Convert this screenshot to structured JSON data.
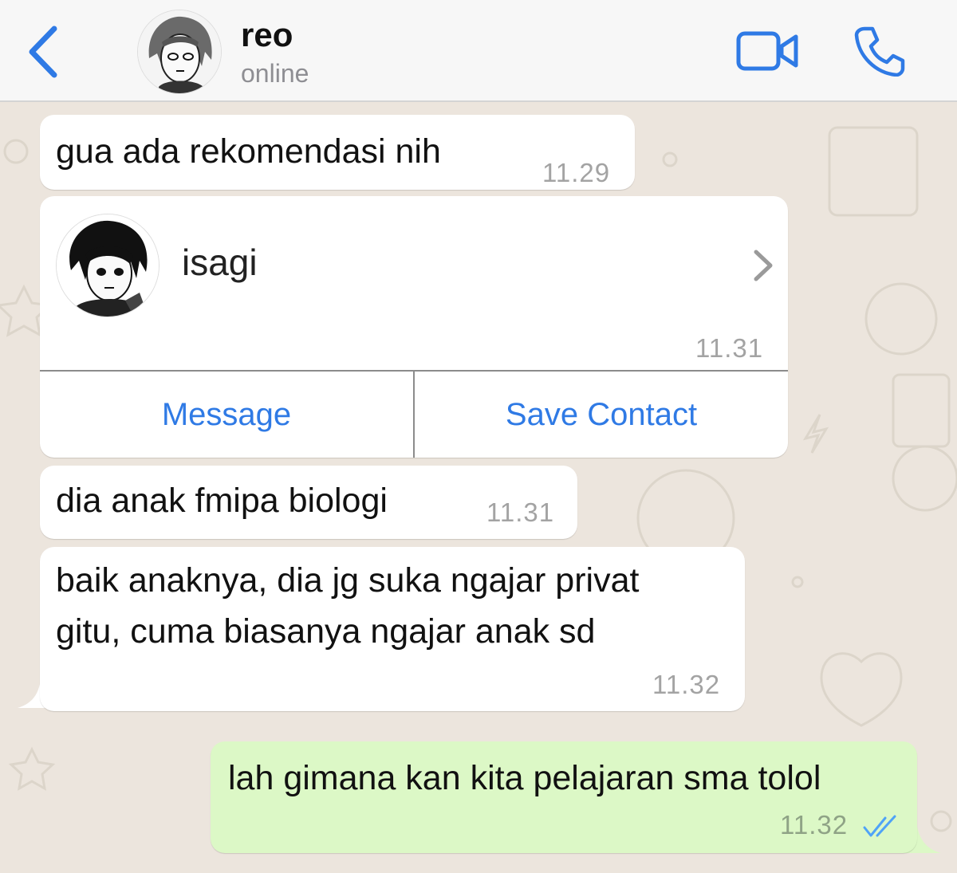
{
  "header": {
    "contact_name": "reo",
    "status": "online"
  },
  "icons": {
    "back": "chevron-left-icon",
    "video": "video-camera-icon",
    "call": "phone-icon"
  },
  "colors": {
    "accent": "#2f7ae5",
    "incoming_bubble": "#ffffff",
    "outgoing_bubble": "#dcf8c6",
    "wallpaper": "#ece5dd"
  },
  "messages": [
    {
      "direction": "incoming",
      "text": "gua ada rekomendasi nih",
      "time": "11.29"
    },
    {
      "direction": "incoming",
      "type": "contact_card",
      "contact_name": "isagi",
      "time": "11.31",
      "actions": [
        "Message",
        "Save Contact"
      ]
    },
    {
      "direction": "incoming",
      "text": "dia anak fmipa biologi",
      "time": "11.31"
    },
    {
      "direction": "incoming",
      "text_lines": [
        "baik anaknya, dia jg suka ngajar privat",
        "gitu, cuma biasanya ngajar anak sd"
      ],
      "time": "11.32"
    },
    {
      "direction": "outgoing",
      "text": "lah gimana kan kita pelajaran sma tolol",
      "time": "11.32",
      "status": "read"
    }
  ]
}
